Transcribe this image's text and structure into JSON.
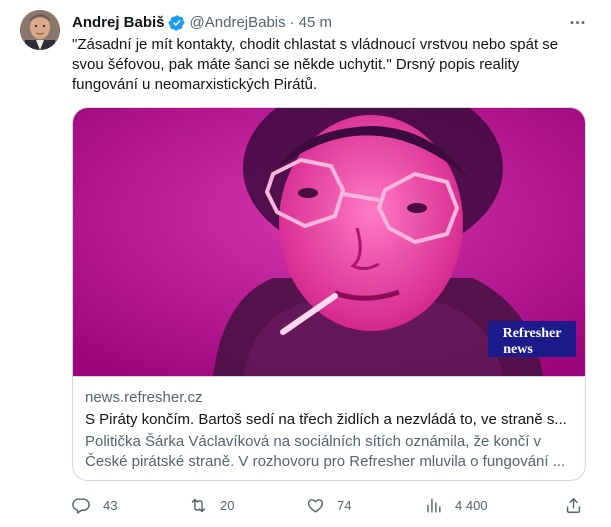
{
  "author": {
    "name": "Andrej Babiš",
    "handle": "@AndrejBabis",
    "separator": "·",
    "time": "45 m"
  },
  "tweet": {
    "text_lines": [
      "\"Zásadní je mít kontakty, chodit chlastat s vládnoucí vrstvou nebo spát se",
      "svou šéfovou, pak máte šanci se někde uchytit.\" Drsný popis reality",
      "fungování u neomarxistických Pirátů."
    ]
  },
  "card": {
    "logo_line1": "Refresher",
    "logo_line2": "news",
    "domain": "news.refresher.cz",
    "title": "S Piráty končím. Bartoš sedí na třech židlích a nezvládá to, ve straně s...",
    "description_lines": [
      "Politička Šárka Václavíková na sociálních sítích oznámila, že končí v",
      "České pirátské straně. V rozhovoru pro Refresher mluvila o fungování ..."
    ]
  },
  "actions": {
    "replies": "43",
    "retweets": "20",
    "likes": "74",
    "views": "4 400"
  },
  "icons": [
    "more-icon",
    "verified-badge-icon",
    "reply-icon",
    "retweet-icon",
    "like-icon",
    "views-icon",
    "share-icon"
  ],
  "colors": {
    "text": "#0f1419",
    "secondary": "#536471",
    "verified": "#1d9bf0",
    "border": "#cfd9de",
    "card_image_tint": "#e0158c",
    "logo_bg": "#1d1a8c"
  }
}
